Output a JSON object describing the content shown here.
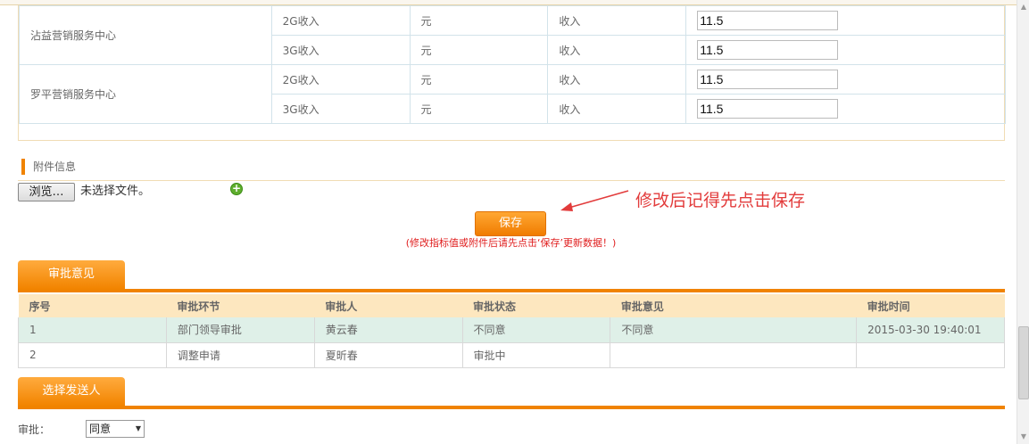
{
  "indicators": [
    {
      "org": "沾益营销服务中心",
      "rows": [
        {
          "item": "2G收入",
          "unit": "元",
          "type": "收入",
          "value": "11.5"
        },
        {
          "item": "3G收入",
          "unit": "元",
          "type": "收入",
          "value": "11.5"
        }
      ]
    },
    {
      "org": "罗平营销服务中心",
      "rows": [
        {
          "item": "2G收入",
          "unit": "元",
          "type": "收入",
          "value": "11.5"
        },
        {
          "item": "3G收入",
          "unit": "元",
          "type": "收入",
          "value": "11.5"
        }
      ]
    }
  ],
  "attachment": {
    "section_title": "附件信息",
    "browse_label": "浏览…",
    "no_file_text": "未选择文件。",
    "add_icon": "plus-circle-icon"
  },
  "annotation": "修改后记得先点击保存",
  "save": {
    "label": "保存",
    "hint": "(修改指标值或附件后请先点击‘保存’更新数据！)"
  },
  "approval": {
    "tab_label": "审批意见",
    "columns": [
      "序号",
      "审批环节",
      "审批人",
      "审批状态",
      "审批意见",
      "审批时间"
    ],
    "rows": [
      [
        "1",
        "部门领导审批",
        "黄云春",
        "不同意",
        "不同意",
        "2015-03-30 19:40:01"
      ],
      [
        "2",
        "调整申请",
        "夏昕春",
        "审批中",
        "",
        ""
      ]
    ]
  },
  "send": {
    "tab_label": "选择发送人",
    "approve_label": "审批：",
    "approve_value": "同意"
  },
  "colors": {
    "accent": "#f08300",
    "header_bg": "#fde7bf",
    "highlight_row": "#dff0e8",
    "warning_text": "#e02020"
  }
}
